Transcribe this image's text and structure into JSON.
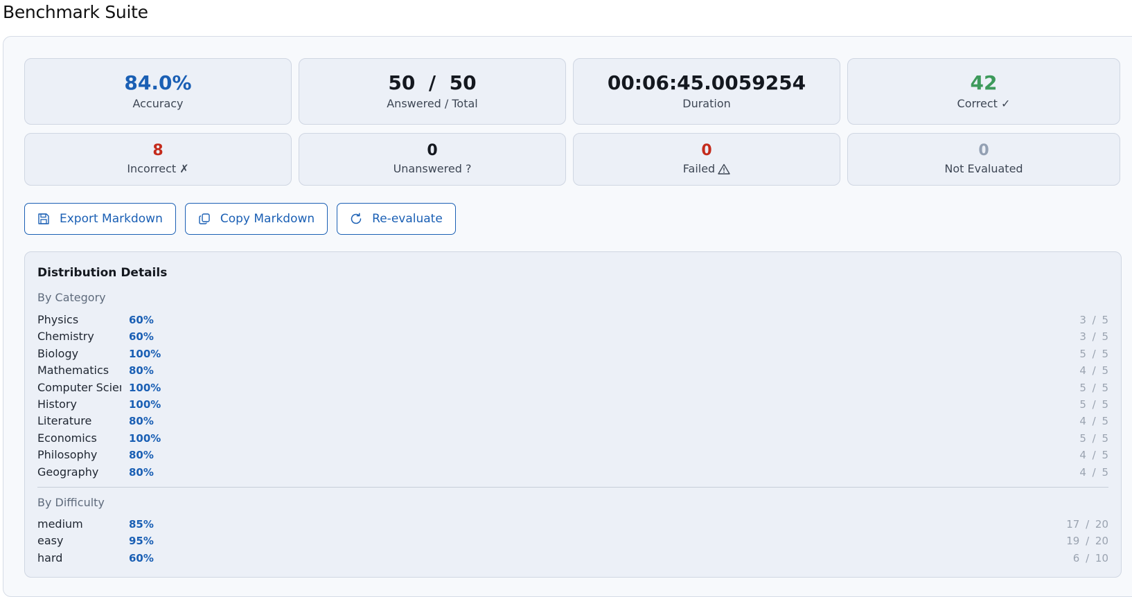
{
  "header": {
    "title": "Benchmark Suite"
  },
  "stats": {
    "accuracy": {
      "value": "84.0%",
      "label": "Accuracy"
    },
    "answered": {
      "value": "50  /  50",
      "label": "Answered / Total"
    },
    "duration": {
      "value": "00:06:45.0059254",
      "label": "Duration"
    },
    "correct": {
      "value": "42",
      "label": "Correct ✓"
    },
    "incorrect": {
      "value": "8",
      "label": "Incorrect ✗"
    },
    "unanswered": {
      "value": "0",
      "label": "Unanswered ?"
    },
    "failed": {
      "value": "0",
      "label": "Failed"
    },
    "not_evaluated": {
      "value": "0",
      "label": "Not Evaluated"
    }
  },
  "actions": {
    "export_label": "Export Markdown",
    "copy_label": "Copy Markdown",
    "reevaluate_label": "Re-evaluate"
  },
  "distribution": {
    "title": "Distribution Details",
    "by_category_label": "By Category",
    "by_difficulty_label": "By Difficulty",
    "categories": [
      {
        "name": "Physics",
        "pct": "60%",
        "count": "3 / 5"
      },
      {
        "name": "Chemistry",
        "pct": "60%",
        "count": "3 / 5"
      },
      {
        "name": "Biology",
        "pct": "100%",
        "count": "5 / 5"
      },
      {
        "name": "Mathematics",
        "pct": "80%",
        "count": "4 / 5"
      },
      {
        "name": "Computer Science",
        "pct": "100%",
        "count": "5 / 5"
      },
      {
        "name": "History",
        "pct": "100%",
        "count": "5 / 5"
      },
      {
        "name": "Literature",
        "pct": "80%",
        "count": "4 / 5"
      },
      {
        "name": "Economics",
        "pct": "100%",
        "count": "5 / 5"
      },
      {
        "name": "Philosophy",
        "pct": "80%",
        "count": "4 / 5"
      },
      {
        "name": "Geography",
        "pct": "80%",
        "count": "4 / 5"
      }
    ],
    "difficulties": [
      {
        "name": "medium",
        "pct": "85%",
        "count": "17 / 20"
      },
      {
        "name": "easy",
        "pct": "95%",
        "count": "19 / 20"
      },
      {
        "name": "hard",
        "pct": "60%",
        "count": "6 / 10"
      }
    ]
  },
  "colors": {
    "accent": "#1a5fb4",
    "success": "#3d9a5b",
    "error": "#c42b1c",
    "muted": "#93a0b3"
  },
  "icons": {
    "export": "save-icon",
    "copy": "copy-icon",
    "reevaluate": "refresh-icon",
    "failed": "warning-icon"
  }
}
